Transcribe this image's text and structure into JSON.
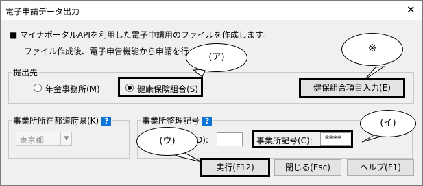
{
  "window": {
    "title": "電子申請データ出力",
    "close_glyph": "✕"
  },
  "message": {
    "bullet": "■",
    "line1": "マイナポータルAPIを利用した電子申請用のファイルを作成します。",
    "line2": "ファイル作成後、電子申告機能から申請を行って"
  },
  "destination": {
    "legend": "提出先",
    "options": [
      {
        "label": "年金事務所(M)",
        "selected": false
      },
      {
        "label": "健康保険組合(S)",
        "selected": true
      }
    ],
    "insurer_button": "健保組合項目入力(E)"
  },
  "prefecture": {
    "legend": "事業所所在都道府県(K)",
    "help": "?",
    "selected": "東京都"
  },
  "office": {
    "legend": "事業所整理記号",
    "help": "?",
    "partial_label": "D):",
    "code_label": "事業所記号(C):",
    "code_value": "****"
  },
  "buttons": {
    "execute": "実行(F12)",
    "close": "閉じる(Esc)",
    "help": "ヘルプ(F1)"
  },
  "callouts": {
    "a": "(ア)",
    "b": "※",
    "c": "(イ)",
    "d": "(ウ)"
  }
}
